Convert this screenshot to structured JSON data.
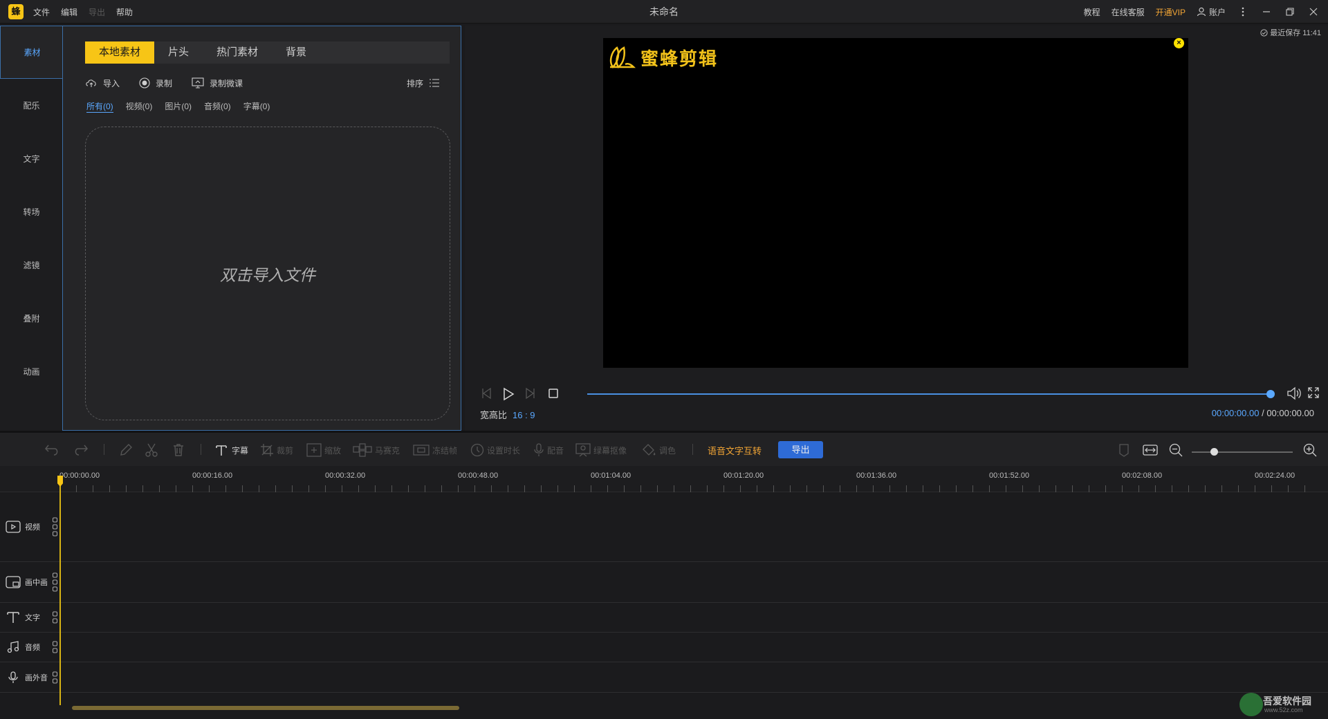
{
  "app": {
    "logo": "蜂",
    "title": "未命名",
    "menu": [
      "文件",
      "编辑",
      "导出",
      "帮助"
    ],
    "right": {
      "tutorial": "教程",
      "support": "在线客服",
      "vip": "开通VIP",
      "account": "账户"
    }
  },
  "leftnav": [
    "素材",
    "配乐",
    "文字",
    "转场",
    "滤镜",
    "叠附",
    "动画"
  ],
  "media": {
    "tabs": [
      "本地素材",
      "片头",
      "热门素材",
      "背景"
    ],
    "actions": {
      "import": "导入",
      "record": "录制",
      "record_lesson": "录制微课",
      "sort": "排序"
    },
    "filters": [
      "所有(0)",
      "视频(0)",
      "图片(0)",
      "音频(0)",
      "字幕(0)"
    ],
    "dropzone": "双击导入文件"
  },
  "preview": {
    "saved": "最近保存 11:41",
    "watermark": "蜜蜂剪辑",
    "ratio_label": "宽高比",
    "ratio_value": "16 : 9",
    "time_current": "00:00:00.00",
    "time_sep": "/",
    "time_total": "00:00:00.00",
    "progress": 1.0
  },
  "toolbar": {
    "subtitle": "字幕",
    "crop": "裁剪",
    "zoom": "缩放",
    "mosaic": "马赛克",
    "freeze": "冻结帧",
    "duration": "设置时长",
    "voiceover": "配音",
    "chroma": "绿幕抠像",
    "color": "调色",
    "speech": "语音文字互转",
    "export": "导出",
    "zoom_level": 0.22
  },
  "ruler": [
    "00:00:00.00",
    "00:00:16.00",
    "00:00:32.00",
    "00:00:48.00",
    "00:01:04.00",
    "00:01:20.00",
    "00:01:36.00",
    "00:01:52.00",
    "00:02:08.00",
    "00:02:24.00"
  ],
  "tracks": [
    "视频",
    "画中画",
    "文字",
    "音频",
    "画外音"
  ],
  "badge": {
    "text": "吾爱软件园",
    "sub": "www.52z.com"
  }
}
